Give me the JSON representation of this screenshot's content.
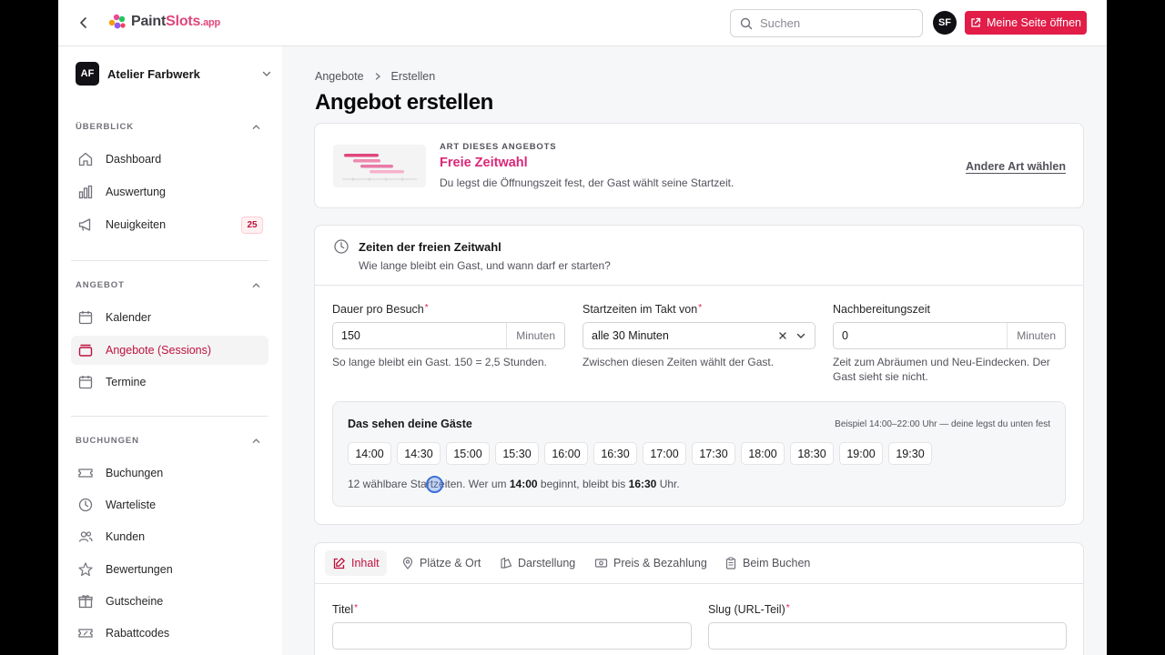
{
  "topbar": {
    "logo_part1": "Paint",
    "logo_part2": "Slots",
    "logo_tld": ".app",
    "search_placeholder": "Suchen",
    "user_initials": "SF",
    "open_page_label": "Meine Seite öffnen"
  },
  "sidebar": {
    "workspace_initials": "AF",
    "workspace_name": "Atelier Farbwerk",
    "sections": [
      {
        "title": "ÜBERBLICK",
        "items": [
          {
            "label": "Dashboard",
            "icon": "home-icon"
          },
          {
            "label": "Auswertung",
            "icon": "bar-chart-icon"
          },
          {
            "label": "Neuigkeiten",
            "icon": "megaphone-icon",
            "badge": "25"
          }
        ]
      },
      {
        "title": "ANGEBOT",
        "items": [
          {
            "label": "Kalender",
            "icon": "calendar-icon"
          },
          {
            "label": "Angebote (Sessions)",
            "icon": "layers-icon",
            "active": true
          },
          {
            "label": "Termine",
            "icon": "calendar-clock-icon"
          }
        ]
      },
      {
        "title": "BUCHUNGEN",
        "items": [
          {
            "label": "Buchungen",
            "icon": "ticket-icon"
          },
          {
            "label": "Warteliste",
            "icon": "clock-icon"
          },
          {
            "label": "Kunden",
            "icon": "users-icon"
          },
          {
            "label": "Bewertungen",
            "icon": "star-icon"
          },
          {
            "label": "Gutscheine",
            "icon": "gift-icon"
          },
          {
            "label": "Rabattcodes",
            "icon": "ticket-percent-icon"
          }
        ]
      }
    ]
  },
  "main": {
    "breadcrumb": [
      "Angebote",
      "Erstellen"
    ],
    "title": "Angebot erstellen",
    "type_card": {
      "eyebrow": "ART DIESES ANGEBOTS",
      "name": "Freie Zeitwahl",
      "description": "Du legst die Öffnungszeit fest, der Gast wählt seine Startzeit.",
      "change_link": "Andere Art wählen"
    },
    "times": {
      "title": "Zeiten der freien Zeitwahl",
      "subtitle": "Wie lange bleibt ein Gast, und wann darf er starten?",
      "duration": {
        "label": "Dauer pro Besuch",
        "value": "150",
        "unit": "Minuten",
        "helper": "So lange bleibt ein Gast. 150 = 2,5 Stunden."
      },
      "interval": {
        "label": "Startzeiten im Takt von",
        "value": "alle 30 Minuten",
        "helper": "Zwischen diesen Zeiten wählt der Gast."
      },
      "cleanup": {
        "label": "Nachbereitungszeit",
        "value": "0",
        "unit": "Minuten",
        "helper": "Zeit zum Abräumen und Neu-Eindecken. Der Gast sieht sie nicht."
      },
      "preview": {
        "title": "Das sehen deine Gäste",
        "hint": "Beispiel 14:00–22:00 Uhr — deine legst du unten fest",
        "slots": [
          "14:00",
          "14:30",
          "15:00",
          "15:30",
          "16:00",
          "16:30",
          "17:00",
          "17:30",
          "18:00",
          "18:30",
          "19:00",
          "19:30"
        ],
        "note_prefix": "12 wählbare Startzeiten. Wer um ",
        "note_start": "14:00",
        "note_mid": " beginnt, bleibt bis ",
        "note_end": "16:30",
        "note_suffix": " Uhr."
      }
    },
    "tabs": [
      "Inhalt",
      "Plätze & Ort",
      "Darstellung",
      "Preis & Bezahlung",
      "Beim Buchen"
    ],
    "fields": {
      "title_label": "Titel",
      "slug_label": "Slug (URL-Teil)"
    }
  }
}
